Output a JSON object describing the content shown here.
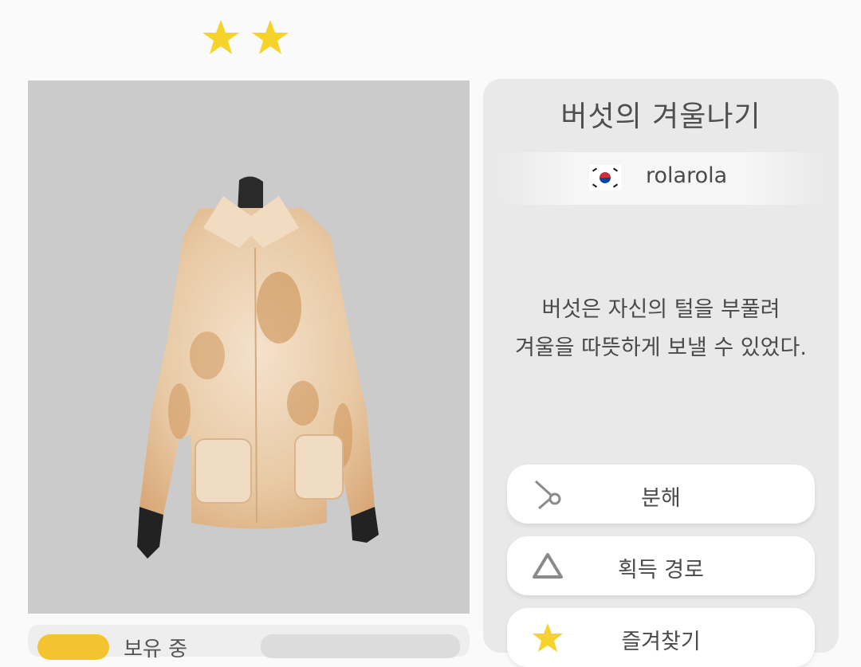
{
  "rating": {
    "stars": 2,
    "color": "#f6d32a"
  },
  "item": {
    "title": "버섯의 겨울나기",
    "author": {
      "name": "rolarola",
      "flag_icon": "south-korea-flag-icon"
    },
    "description_lines": [
      "버섯은 자신의 털을 부풀려",
      "겨울을 따뜻하게 보낼 수 있었다."
    ],
    "preview": {
      "background": "#cbcbcb",
      "subject": "jacket-image"
    }
  },
  "actions": [
    {
      "label": "분해",
      "icon": "scissors-icon"
    },
    {
      "label": "획득 경로",
      "icon": "triangle-icon"
    },
    {
      "label": "즐겨찾기",
      "icon": "star-icon"
    }
  ],
  "bottom_bar": {
    "status": "보유 중"
  }
}
